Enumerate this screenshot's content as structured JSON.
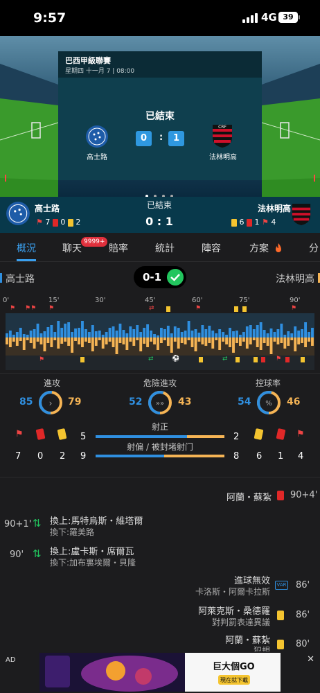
{
  "status_bar": {
    "time": "9:57",
    "network": "4G",
    "battery": "39"
  },
  "match": {
    "league": "巴西甲級聯賽",
    "datetime": "星期四 十一月 7 | 08:00",
    "status": "已結束",
    "home": {
      "name": "高士路",
      "score": "0",
      "color": "#1e5ca8"
    },
    "away": {
      "name": "法林明高",
      "score": "1",
      "color": "#d0102a"
    },
    "score_compact": "0 : 1",
    "score_badge": "0-1",
    "home_counts": {
      "corners": "7",
      "red": "0",
      "yellow": "2"
    },
    "away_counts": {
      "yellow": "6",
      "red": "1",
      "corners": "4"
    }
  },
  "tabs": [
    {
      "label": "概況",
      "active": true
    },
    {
      "label": "聊天",
      "badge": "9999+"
    },
    {
      "label": "賠率"
    },
    {
      "label": "統計"
    },
    {
      "label": "陣容"
    },
    {
      "label": "方案"
    },
    {
      "label": "分"
    }
  ],
  "timeline": {
    "minute_labels": [
      "0'",
      "15'",
      "30'",
      "45'",
      "60'",
      "75'",
      "90'"
    ],
    "home_color": "#2f8fe0",
    "away_color": "#f5b455",
    "home_bars": [
      6,
      10,
      4,
      8,
      14,
      5,
      4,
      10,
      12,
      20,
      6,
      9,
      15,
      18,
      8,
      24,
      14,
      20,
      22,
      8,
      13,
      14,
      24,
      12,
      8,
      18,
      9,
      10,
      4,
      8,
      14,
      16,
      10,
      20,
      11,
      6,
      16,
      12,
      18,
      8,
      14,
      19,
      10,
      5,
      3,
      14,
      12,
      17,
      6,
      16,
      14,
      8,
      10,
      24,
      10,
      12,
      7,
      18,
      12,
      17,
      10,
      6,
      12,
      8,
      4,
      14,
      9,
      10,
      4,
      8,
      16,
      18,
      12,
      18,
      22,
      11,
      6,
      13,
      8,
      12,
      20,
      4,
      9,
      6,
      16,
      10,
      12,
      22,
      8,
      14
    ],
    "away_bars": [
      10,
      14,
      6,
      12,
      5,
      18,
      4,
      8,
      16,
      6,
      10,
      20,
      8,
      14,
      4,
      16,
      9,
      6,
      12,
      22,
      5,
      10,
      14,
      6,
      8,
      20,
      12,
      4,
      16,
      10,
      6,
      14,
      24,
      8,
      10,
      18,
      6,
      12,
      4,
      20,
      9,
      14,
      6,
      10,
      18,
      8,
      4,
      12,
      22,
      6,
      16,
      8,
      10,
      4,
      14,
      20,
      6,
      10,
      12,
      8,
      16,
      4,
      18,
      6,
      10,
      14,
      22,
      8,
      12,
      6,
      16,
      10,
      4,
      14,
      18,
      8,
      12,
      24,
      6,
      10,
      8,
      16,
      12,
      4,
      20,
      10,
      8,
      14,
      6,
      12
    ]
  },
  "stats": {
    "attack": {
      "label": "進攻",
      "home": "85",
      "away": "79",
      "home_share": 0.52
    },
    "danger": {
      "label": "危險進攻",
      "home": "52",
      "away": "43",
      "home_share": 0.55
    },
    "possession": {
      "label": "控球率",
      "home": "54",
      "away": "46",
      "home_share": 0.54
    },
    "on_target": {
      "label": "射正",
      "home": "5",
      "away": "2",
      "home_share": 0.71
    },
    "off_target": {
      "label": "射偏 / 被封堵射门",
      "home": "9",
      "away": "8",
      "home_share": 0.53
    },
    "home_counts": {
      "corners": "7",
      "red": "0",
      "yellow": "2"
    },
    "away_counts": {
      "yellow": "6",
      "red": "1",
      "corners": "4"
    }
  },
  "events": [
    {
      "side": "away",
      "player": "阿蘭・蘇紮",
      "minute": "90+4'",
      "type": "red-card"
    },
    {
      "side": "home",
      "minute": "90+1'",
      "in": "換上:馬特烏斯・維塔爾",
      "out": "換下:羅美路",
      "type": "substitution"
    },
    {
      "side": "home",
      "minute": "90'",
      "in": "換上:盧卡斯・席爾瓦",
      "out": "換下:加布裏埃爾・貝隆",
      "type": "substitution"
    },
    {
      "side": "away",
      "title": "進球無效",
      "player": "卡洛斯・阿爾卡拉斯",
      "minute": "86'",
      "type": "var",
      "var_label": "VAR"
    },
    {
      "side": "away",
      "player": "阿萊克斯・桑德羅",
      "detail": "對判罰表達異議",
      "minute": "86'",
      "type": "yellow-card"
    },
    {
      "side": "away",
      "player": "阿蘭・蘇紮",
      "detail": "犯規",
      "minute": "80'",
      "type": "yellow-card"
    }
  ],
  "ad": {
    "label": "AD",
    "close": "✕",
    "text": "巨大個GO",
    "button": "現在就下載"
  }
}
